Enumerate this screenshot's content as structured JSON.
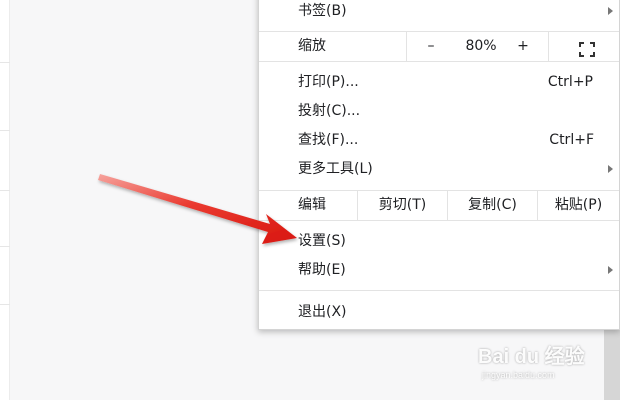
{
  "menu": {
    "bookmarks": "书签(B)",
    "zoom": {
      "label": "缩放",
      "minus": "–",
      "value": "80%",
      "plus": "+"
    },
    "print": {
      "label": "打印(P)...",
      "shortcut": "Ctrl+P"
    },
    "cast": "投射(C)...",
    "find": {
      "label": "查找(F)...",
      "shortcut": "Ctrl+F"
    },
    "more_tools": "更多工具(L)",
    "edit": {
      "label": "编辑",
      "cut": "剪切(T)",
      "copy": "复制(C)",
      "paste": "粘贴(P)"
    },
    "settings": "设置(S)",
    "help": "帮助(E)",
    "exit": "退出(X)"
  },
  "annotation": {
    "arrow_color": "#e8201b",
    "points_to": "settings"
  },
  "watermark": {
    "main": "Bai du 经验",
    "sub": "jingyan.baidu.com"
  },
  "colors": {
    "menu_bg": "#ffffff",
    "separator": "#e3e3e3",
    "page_bg": "#f7f7f8"
  }
}
